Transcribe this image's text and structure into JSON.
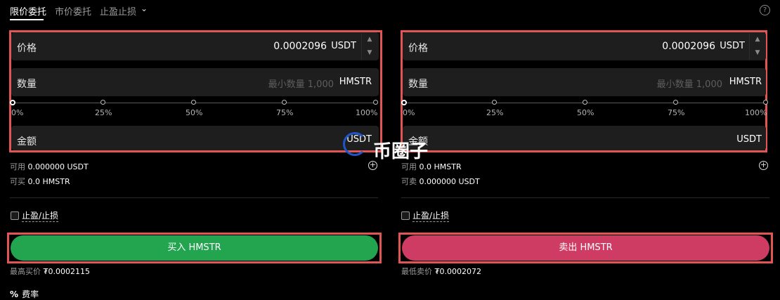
{
  "tabs": [
    {
      "label": "限价委托",
      "active": true
    },
    {
      "label": "市价委托",
      "active": false
    },
    {
      "label": "止盈止损",
      "active": false
    }
  ],
  "buy": {
    "price_label": "价格",
    "price_value": "0.0002096",
    "price_unit": "USDT",
    "qty_label": "数量",
    "qty_placeholder": "最小数量 1,000",
    "qty_unit": "HMSTR",
    "amount_label": "金额",
    "amount_unit": "USDT",
    "avail_key": "可用",
    "avail_val": "0.000000 USDT",
    "can_key": "可买",
    "can_val": "0.0 HMSTR",
    "tpsl_label": "止盈/止损",
    "button": "买入 HMSTR",
    "best_key": "最高买价",
    "best_val": "₮0.0002115"
  },
  "sell": {
    "price_label": "价格",
    "price_value": "0.0002096",
    "price_unit": "USDT",
    "qty_label": "数量",
    "qty_placeholder": "最小数量 1,000",
    "qty_unit": "HMSTR",
    "amount_label": "金额",
    "amount_unit": "USDT",
    "avail_key": "可用",
    "avail_val": "0.0 HMSTR",
    "can_key": "可卖",
    "can_val": "0.000000 USDT",
    "tpsl_label": "止盈/止损",
    "button": "卖出 HMSTR",
    "best_key": "最低卖价",
    "best_val": "₮0.0002072"
  },
  "slider_ticks": [
    "0%",
    "25%",
    "50%",
    "75%",
    "100%"
  ],
  "slider_value_percent": 0,
  "fee_label": "费率",
  "watermark": "币圈子",
  "colors": {
    "buy": "#23a550",
    "sell": "#cf3c63",
    "highlight": "#e25555",
    "background": "#000000"
  },
  "icons": {
    "help": "help-icon",
    "plus": "plus-circle-icon",
    "dropdown": "chevron-down-icon",
    "fee": "percent-icon"
  }
}
